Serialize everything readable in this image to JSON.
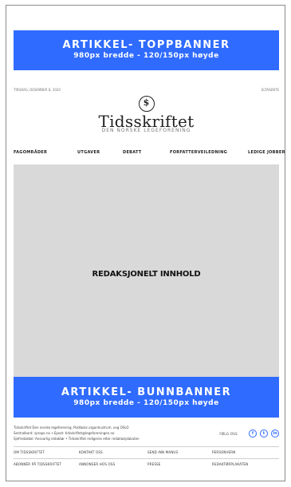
{
  "banners": {
    "top": {
      "title": "ARTIKKEL- TOPPBANNER",
      "subtitle": "980px bredde - 120/150px høyde"
    },
    "bottom": {
      "title": "ARTIKKEL- BUNNBANNER",
      "subtitle": "980px bredde - 120/150px høyde"
    }
  },
  "header": {
    "date": "TIRSDAG, DESEMBER 8, 2020",
    "right_text": "ELTASENTE",
    "logo_symbol": "$",
    "logo_name": "Tidsskriftet",
    "logo_subtitle": "DEN NORSKE LEGEFORENING"
  },
  "nav": {
    "items": [
      "FAGOMRÅDER",
      "UTGAVER",
      "DEBATT",
      "FORFATTERVEILEDNING",
      "LEDIGE JOBBER"
    ]
  },
  "content": {
    "label": "REDAKSJONELT INNHOLD"
  },
  "footer": {
    "text_lines": [
      "Tidsskriftet Den norske legeforening, Postboks organhustrum, ovg OSLO",
      "Sentralbord: sprapo no • Epost: tidsskriftet@legeforeningen.no",
      "Sjefredaktør: Ansvarlig redaktør • Tidsskriftet redigeres etter redaktørplakaten"
    ],
    "social_label": "FØLG OSS",
    "social_icons": [
      {
        "name": "facebook-icon",
        "glyph": "f"
      },
      {
        "name": "twitter-icon",
        "glyph": "t"
      },
      {
        "name": "linkedin-icon",
        "glyph": "in"
      }
    ],
    "links_row1": [
      "OM TIDSSKRIFTET",
      "KONTAKT OSS",
      "SEND INN MANUS",
      "PERSONVERN"
    ],
    "links_row2": [
      "ABONNÉR PÅ TIDSSKRIFTET",
      "ANNONSER HOS OSS",
      "PRESSE",
      "REDAKTØRPLAKATEN"
    ]
  }
}
